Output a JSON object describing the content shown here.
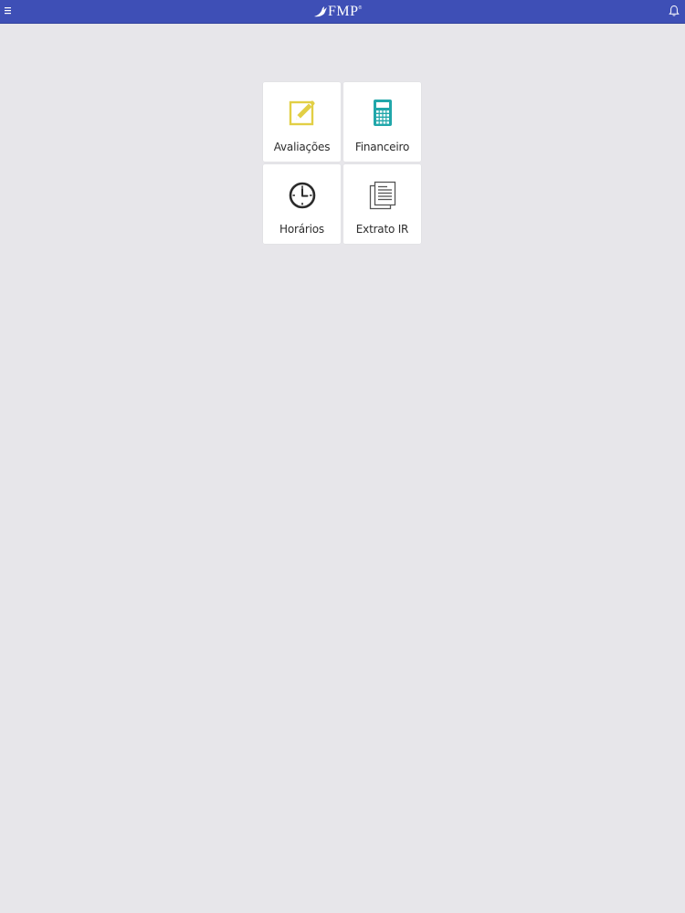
{
  "header": {
    "logo_text": "FMP",
    "logo_mark": "®",
    "menu_icon": "hamburger-menu-icon",
    "bell_icon": "bell-icon",
    "bar_color": "#3e4fb6"
  },
  "tiles": [
    {
      "label": "Avaliações",
      "icon": "edit-icon",
      "color": "#e2cf45"
    },
    {
      "label": "Financeiro",
      "icon": "calculator-icon",
      "color": "#21a7aa"
    },
    {
      "label": "Horários",
      "icon": "clock-icon",
      "color": "#2b2b2b"
    },
    {
      "label": "Extrato IR",
      "icon": "document-icon",
      "color": "#555555"
    }
  ]
}
